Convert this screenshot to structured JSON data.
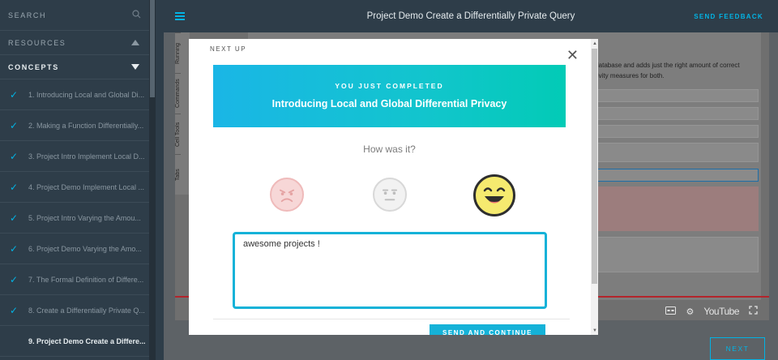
{
  "sidebar": {
    "search_label": "SEARCH",
    "resources_label": "RESOURCES",
    "concepts_label": "CONCEPTS",
    "lessons": [
      {
        "label": "1. Introducing Local and Global Di...",
        "done": true
      },
      {
        "label": "2. Making a Function Differentially...",
        "done": true
      },
      {
        "label": "3. Project Intro Implement Local D...",
        "done": true
      },
      {
        "label": "4. Project Demo Implement Local ...",
        "done": true
      },
      {
        "label": "5. Project Intro Varying the Amou...",
        "done": true
      },
      {
        "label": "6. Project Demo Varying the Amo...",
        "done": true
      },
      {
        "label": "7. The Formal Definition of Differe...",
        "done": true
      },
      {
        "label": "8. Create a Differentially Private Q...",
        "done": true
      },
      {
        "label": "9. Project Demo Create a Differe...",
        "done": false
      }
    ]
  },
  "header": {
    "title": "Project Demo Create a Differentially Private Query",
    "send_feedback": "SEND FEEDBACK"
  },
  "video": {
    "side_tabs": [
      "Running",
      "Commands",
      "Cell Tools",
      "Tabs"
    ],
    "doc_text": "r the database and adds just the right amount of correct sensitivity measures for both.",
    "youtube_label": "YouTube"
  },
  "next_button": "NEXT",
  "modal": {
    "kicker": "YOU JUST COMPLETED",
    "lesson_title": "Introducing Local and Global Differential Privacy",
    "question": "How was it?",
    "feedback_value": "awesome projects !",
    "next_up": "NEXT UP",
    "send_button": "SEND AND CONTINUE"
  },
  "colors": {
    "accent": "#02b3e4",
    "sidebar_bg": "#2e3d49",
    "banner_start": "#1ab6e6",
    "banner_end": "#02cbb6"
  }
}
